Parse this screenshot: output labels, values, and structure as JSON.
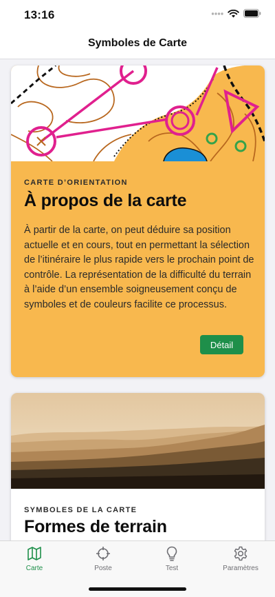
{
  "status_bar": {
    "time": "13:16"
  },
  "nav": {
    "title": "Symboles de Carte"
  },
  "cards": [
    {
      "kicker": "CARTE D’ORIENTATION",
      "title": "À propos de la carte",
      "body": "À partir de la carte, on peut déduire sa position actuelle et en cours, tout en permettant la sélection de l’itinéraire le plus rapide vers le prochain point de contrôle. La représentation de la difficulté du terrain à l’aide d’un ensemble soigneusement conçu de symboles et de couleurs facilite ce processus.",
      "button_label": "Détail",
      "background": "#f8b84e",
      "button_color": "#1e8f4a"
    },
    {
      "kicker": "SYMBOLES DE LA CARTE",
      "title": "Formes de terrain",
      "background": "#ffffff"
    }
  ],
  "tabs": [
    {
      "label": "Carte",
      "icon": "map-icon",
      "active": true
    },
    {
      "label": "Poste",
      "icon": "crosshair-icon",
      "active": false
    },
    {
      "label": "Test",
      "icon": "lightbulb-icon",
      "active": false
    },
    {
      "label": "Paramètres",
      "icon": "gear-icon",
      "active": false
    }
  ],
  "colors": {
    "accent": "#1e8f4a",
    "map_pink": "#e0208e",
    "map_orange": "#f8b84e",
    "map_contour": "#b8671e",
    "map_water": "#1a8fd6"
  }
}
